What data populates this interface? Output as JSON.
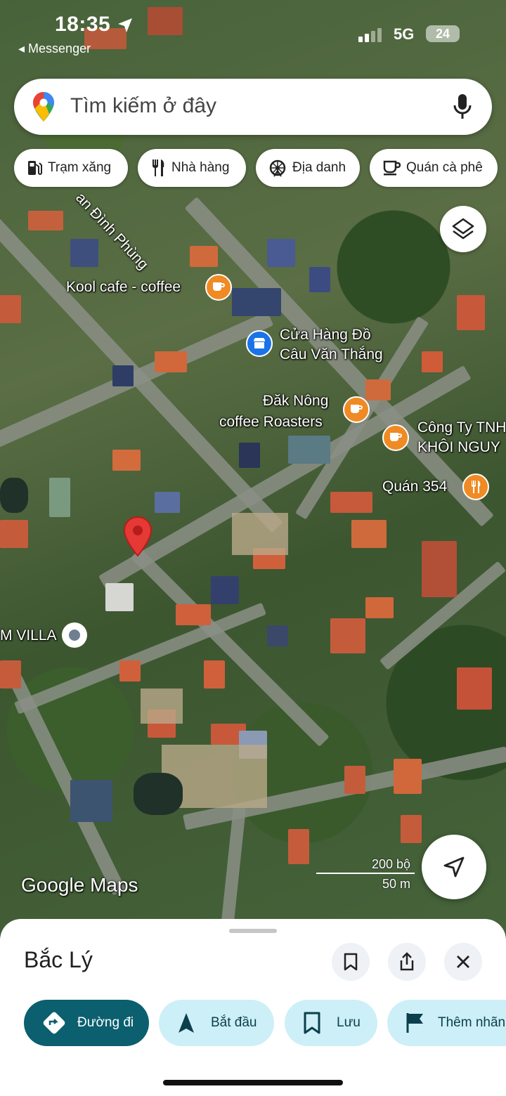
{
  "status_bar": {
    "time": "18:35",
    "back_app": "◂ Messenger",
    "network": "5G",
    "battery": "24"
  },
  "search": {
    "placeholder": "Tìm kiếm ở đây"
  },
  "chips": [
    {
      "label": "Trạm xăng",
      "icon": "gas-station-icon"
    },
    {
      "label": "Nhà hàng",
      "icon": "restaurant-icon"
    },
    {
      "label": "Địa danh",
      "icon": "landmark-icon"
    },
    {
      "label": "Quán cà phê",
      "icon": "coffee-icon"
    }
  ],
  "map": {
    "street_label": "an Đình Phùng",
    "pois": [
      {
        "name": "Kool cafe - coffee",
        "type": "cafe",
        "color": "#f08a24"
      },
      {
        "line1": "Cửa Hàng Đồ",
        "line2": "Câu Văn Thắng",
        "type": "shop",
        "color": "#1a73e8"
      },
      {
        "line1": "Đăk Nông",
        "line2": "coffee Roasters",
        "type": "cafe",
        "color": "#f08a24"
      },
      {
        "line1": "Công Ty TNH",
        "line2": "KHÔI NGUY",
        "type": "cafe",
        "color": "#f08a24"
      },
      {
        "name": "Quán 354",
        "type": "restaurant",
        "color": "#f08a24"
      }
    ],
    "villa_label": "M VILLA",
    "google_logo": "Google Maps",
    "scale_top": "200 bộ",
    "scale_bottom": "50 m"
  },
  "place": {
    "title": "Bắc Lý"
  },
  "actions": [
    {
      "label": "Đường đi",
      "icon": "directions-icon"
    },
    {
      "label": "Bắt đầu",
      "icon": "navigation-arrow-icon"
    },
    {
      "label": "Lưu",
      "icon": "bookmark-icon"
    },
    {
      "label": "Thêm nhãn",
      "icon": "flag-icon"
    }
  ],
  "colors": {
    "accent": "#0b5f6e",
    "secondary": "#cdeff7",
    "poi_orange": "#f08a24",
    "pin_red": "#e53935"
  }
}
